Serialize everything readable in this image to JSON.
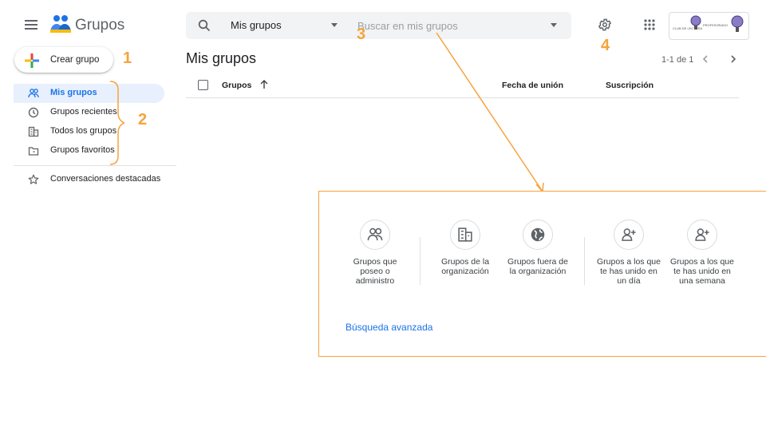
{
  "app": {
    "title": "Grupos"
  },
  "search": {
    "scope": "Mis grupos",
    "placeholder": "Buscar en mis grupos"
  },
  "account": {
    "text_left": "PROFESORADO",
    "text_small": "CLUB DE LECTURA"
  },
  "sidebar": {
    "create_label": "Crear grupo",
    "items": [
      {
        "label": "Mis grupos",
        "icon": "people-icon",
        "active": true
      },
      {
        "label": "Grupos recientes",
        "icon": "clock-icon",
        "active": false
      },
      {
        "label": "Todos los grupos",
        "icon": "building-icon",
        "active": false
      },
      {
        "label": "Grupos favoritos",
        "icon": "folder-star-icon",
        "active": false
      },
      {
        "label": "Conversaciones destacadas",
        "icon": "star-icon",
        "active": false
      }
    ]
  },
  "main": {
    "title": "Mis grupos",
    "pagination": "1-1 de 1",
    "columns": [
      "Grupos",
      "Fecha de unión",
      "Suscripción"
    ]
  },
  "annotations": [
    "1",
    "2",
    "3",
    "4"
  ],
  "filters": [
    {
      "label": "Grupos que poseo o administro",
      "icon": "people-icon"
    },
    {
      "label": "Grupos de la organización",
      "icon": "building-icon"
    },
    {
      "label": "Grupos fuera de la organización",
      "icon": "globe-icon"
    },
    {
      "label": "Grupos a los que te has unido en un día",
      "icon": "person-add-icon"
    },
    {
      "label": "Grupos a los que te has unido en una semana",
      "icon": "person-add-icon"
    }
  ],
  "advanced_search": "Búsqueda avanzada",
  "colors": {
    "accent": "#1a73e8",
    "annotation": "#f6a33b",
    "active_bg": "#e8f0fe"
  }
}
